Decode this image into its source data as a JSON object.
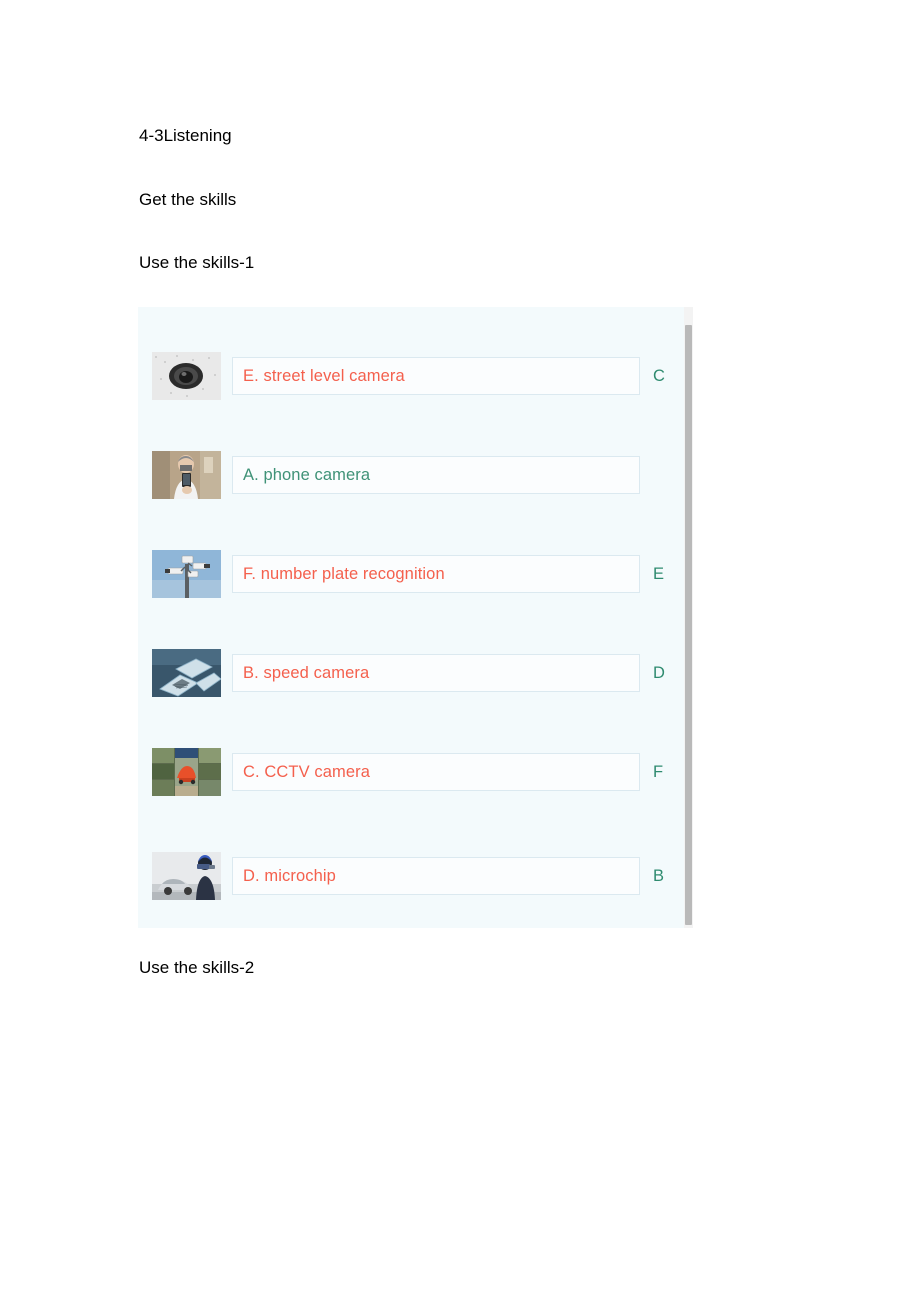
{
  "document": {
    "headings": [
      "4-3Listening",
      "Get the skills",
      "Use the skills-1",
      "Use the skills-2"
    ]
  },
  "exercise": {
    "colors": {
      "panel_background": "#f3fafc",
      "answer_red": "#f4604d",
      "answer_green": "#3f9277",
      "key_letter": "#2e8b6f",
      "box_border": "#dbe9f0"
    },
    "rows": [
      {
        "thumbnail": "dome-ceiling-camera-photo",
        "answer": "E. street level camera",
        "answer_color": "red",
        "key": "C"
      },
      {
        "thumbnail": "man-holding-phone-photo",
        "answer": "A. phone camera",
        "answer_color": "green",
        "key": ""
      },
      {
        "thumbnail": "pole-mounted-cameras-photo",
        "answer": "F.  number plate recognition",
        "answer_color": "red",
        "key": "E"
      },
      {
        "thumbnail": "microchips-photo",
        "answer": "B. speed camera",
        "answer_color": "red",
        "key": "D"
      },
      {
        "thumbnail": "cctv-monitor-wall-red-car-photo",
        "answer": "C. CCTV camera",
        "answer_color": "red",
        "key": "F"
      },
      {
        "thumbnail": "police-speed-gun-car-photo",
        "answer": "D. microchip",
        "answer_color": "red",
        "key": "B"
      }
    ],
    "scrollbar": {
      "orientation": "vertical",
      "position": "right"
    }
  }
}
